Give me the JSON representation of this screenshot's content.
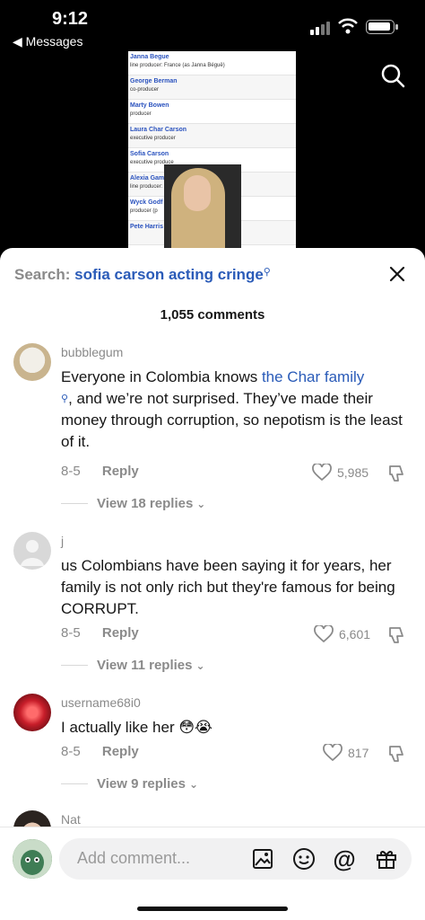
{
  "status": {
    "time": "9:12",
    "back_label": "◀ Messages"
  },
  "video_doc": {
    "rows": [
      {
        "name": "Janna Begue",
        "role": "line producer: France (as Janna Béguë)"
      },
      {
        "name": "George Berman",
        "role": "co-producer"
      },
      {
        "name": "Marty Bowen",
        "role": "producer"
      },
      {
        "name": "Laura Char Carson",
        "role": "executive producer"
      },
      {
        "name": "Sofia Carson",
        "role": "executive produce"
      },
      {
        "name": "Alexia Gamba",
        "role": "line producer: It"
      },
      {
        "name": "Wyck Godf",
        "role": "producer (p"
      },
      {
        "name": "Pete Harris",
        "role": ""
      }
    ]
  },
  "comments_panel": {
    "search_prefix": "Search:",
    "search_term": "sofia carson acting cringe",
    "count_label": "1,055 comments",
    "comments": [
      {
        "username": "bubblegum",
        "text_before": "Everyone in Colombia knows ",
        "text_link": "the Char family",
        "text_after": ", and we’re not surprised. They’ve made their money through corruption, so nepotism is the least of it.",
        "date": "8-5",
        "reply_label": "Reply",
        "likes": "5,985",
        "view_replies": "View 18 replies"
      },
      {
        "username": "j",
        "text": "us Colombians have been saying it for years, her family is not only rich but they're famous for being CORRUPT.",
        "date": "8-5",
        "reply_label": "Reply",
        "likes": "6,601",
        "view_replies": "View 11 replies"
      },
      {
        "username": "username68i0",
        "text": "I actually like her 😳😭",
        "date": "8-5",
        "reply_label": "Reply",
        "likes": "817",
        "view_replies": "View 9 replies"
      },
      {
        "username": "Nat"
      }
    ]
  },
  "composer": {
    "placeholder": "Add comment..."
  },
  "colors": {
    "link": "#2a5bb8",
    "muted": "#8a8a8a",
    "text": "#161616"
  }
}
